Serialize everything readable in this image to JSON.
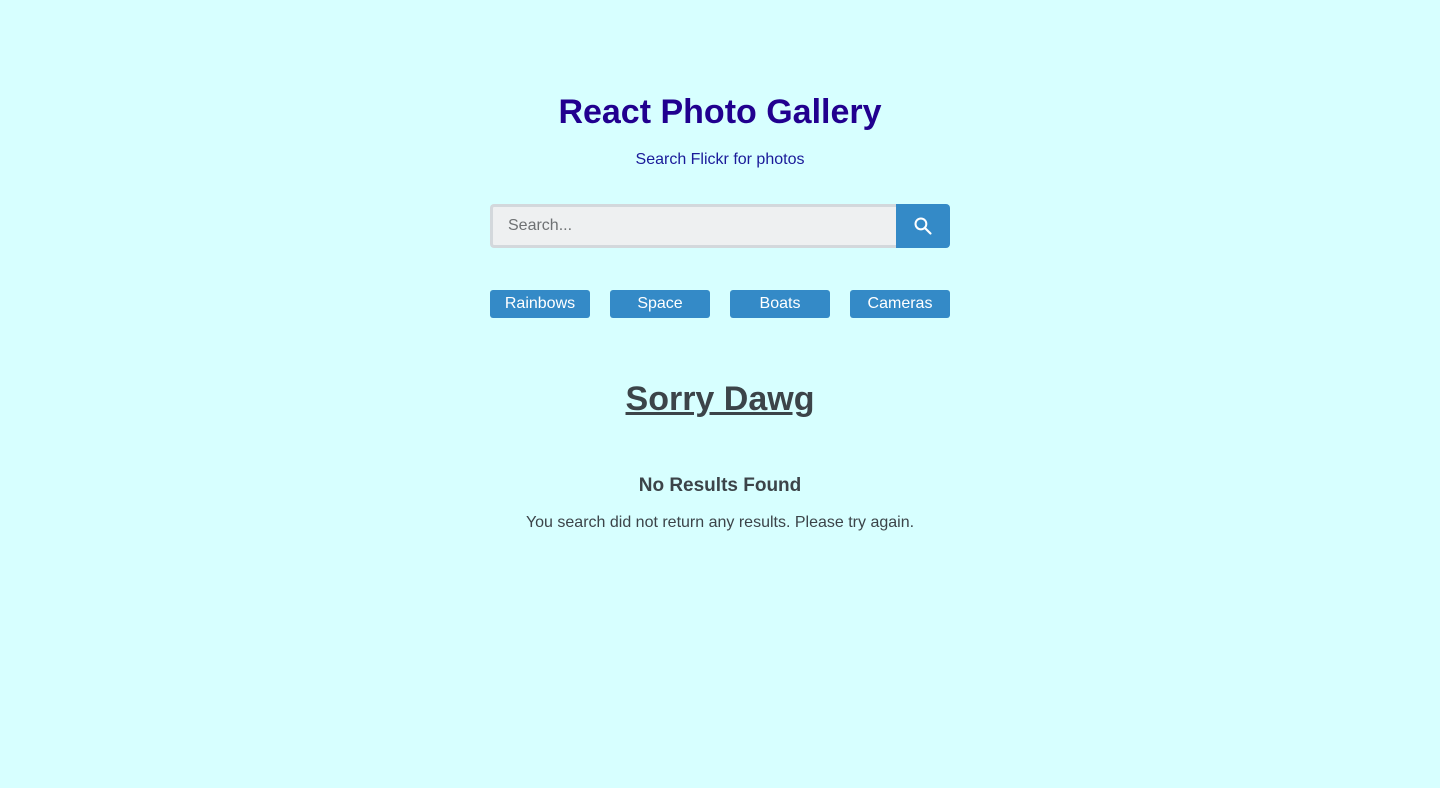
{
  "header": {
    "title": "React Photo Gallery",
    "subtitle": "Search Flickr for photos"
  },
  "search": {
    "placeholder": "Search...",
    "value": "",
    "button_icon": "search-icon"
  },
  "nav": {
    "items": [
      {
        "label": "Rainbows"
      },
      {
        "label": "Space"
      },
      {
        "label": "Boats"
      },
      {
        "label": "Cameras"
      }
    ]
  },
  "results": {
    "heading": "Sorry Dawg",
    "no_results_title": "No Results Found",
    "no_results_message": "You search did not return any results. Please try again."
  },
  "colors": {
    "background": "#d7ffff",
    "title": "#21008f",
    "accent": "#348ac7",
    "text": "#3c4449"
  }
}
